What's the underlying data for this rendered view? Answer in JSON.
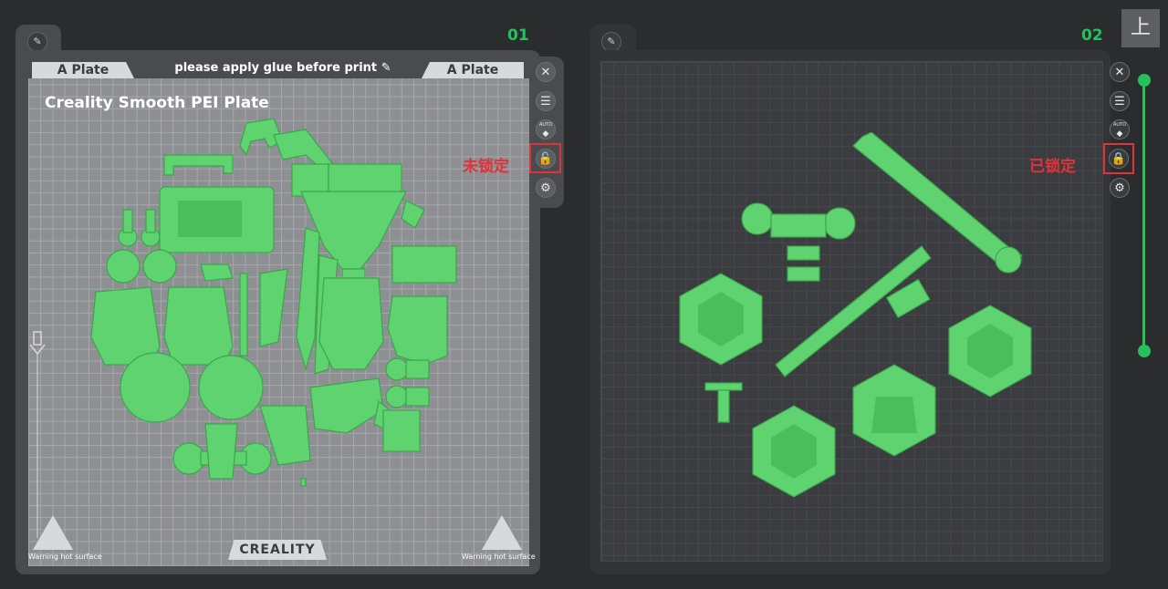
{
  "plate1": {
    "index": "01",
    "top_tag_left": "A Plate",
    "top_tag_right": "A Plate",
    "notice": "please apply glue before print",
    "plate_type": "Creality Smooth PEI Plate",
    "brand": "CREALITY",
    "warning_left": "Warning hot surface",
    "warning_right": "Warning hot surface",
    "lock_annotation": "未锁定",
    "auto_label": "AUTO"
  },
  "plate2": {
    "index": "02",
    "lock_annotation": "已锁定",
    "auto_label": "AUTO"
  },
  "view": {
    "top_view_icon": "上"
  },
  "icons": {
    "edit": "pencil-icon",
    "close": "close-icon",
    "list": "list-icon",
    "auto": "auto-arrange-icon",
    "lock": "lock-icon",
    "settings": "gear-icon"
  },
  "colors": {
    "model": "#5ed36f",
    "accent": "#24c25a",
    "annotation": "#e0323a"
  }
}
